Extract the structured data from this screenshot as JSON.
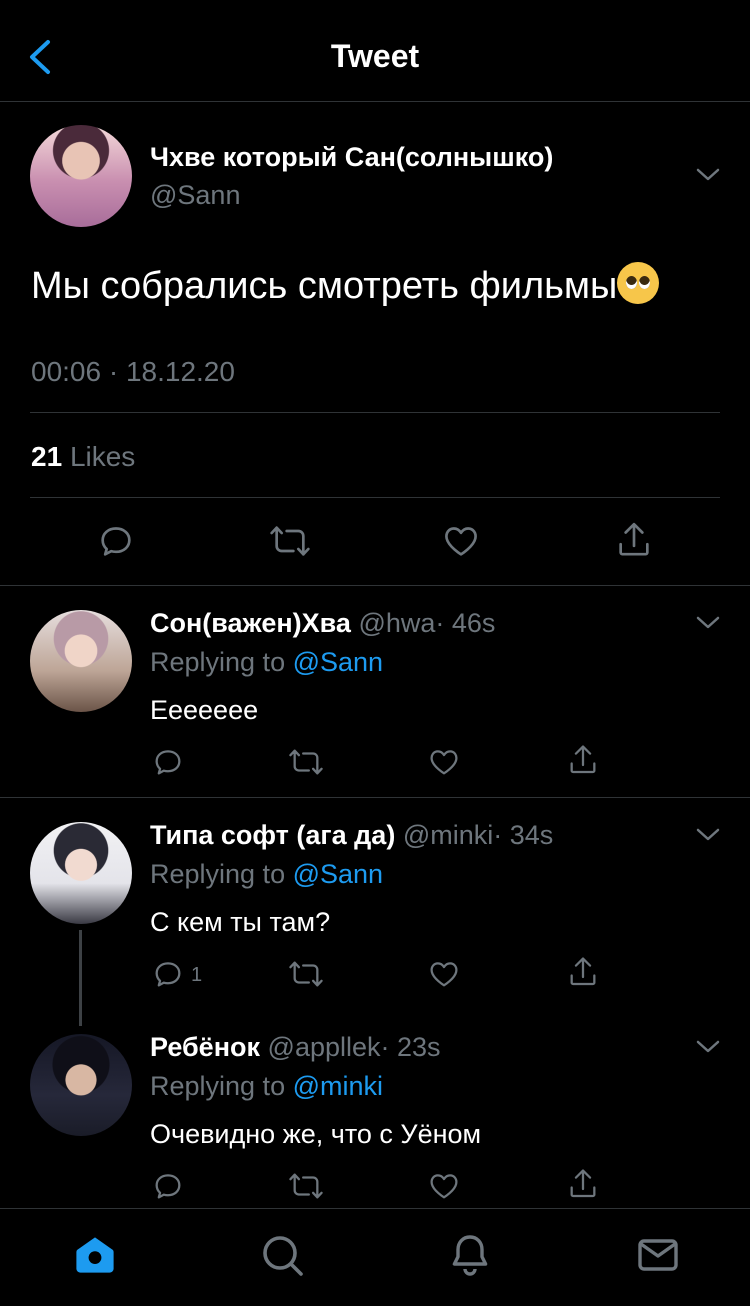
{
  "header": {
    "title": "Tweet"
  },
  "tweet": {
    "author_name": "Чхве который Сан(солнышко)",
    "handle": "@Sann",
    "text": "Мы собрались смотреть фильмы",
    "time": "00:06 · 18.12.20",
    "likes_count": "21",
    "likes_label": "Likes"
  },
  "replies": [
    {
      "name": "Сон(важен)Хва",
      "handle": "@hwa",
      "age": "· 46s",
      "replying_label": "Replying to",
      "replying_to": "@Sann",
      "text": "Еееееее",
      "reply_count": ""
    },
    {
      "name": "Типа софт (ага да)",
      "handle": "@minki",
      "age": "· 34s",
      "replying_label": "Replying to",
      "replying_to": "@Sann",
      "text": "С кем ты там?",
      "reply_count": "1"
    },
    {
      "name": "Ребёнок",
      "handle": "@appllek",
      "age": "· 23s",
      "replying_label": "Replying to",
      "replying_to": "@minki",
      "text": "Очевидно же, что с Уёном",
      "reply_count": ""
    }
  ],
  "icons": {
    "back": "chevron-left-icon",
    "actions": [
      "reply-icon",
      "retweet-icon",
      "like-icon",
      "share-icon"
    ],
    "tabs": [
      "home-icon",
      "search-icon",
      "notifications-icon",
      "messages-icon"
    ]
  },
  "colors": {
    "accent": "#1d9bf0",
    "muted": "#6e767d",
    "divider": "#2f3336",
    "background": "#000000"
  }
}
